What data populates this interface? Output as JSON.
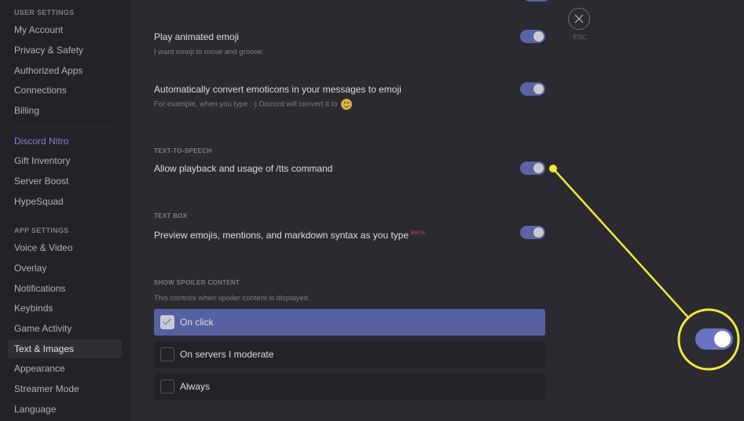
{
  "sidebar": {
    "user_settings_header": "USER SETTINGS",
    "user_items": [
      {
        "label": "My Account"
      },
      {
        "label": "Privacy & Safety"
      },
      {
        "label": "Authorized Apps"
      },
      {
        "label": "Connections"
      },
      {
        "label": "Billing"
      }
    ],
    "nitro_items": [
      {
        "label": "Discord Nitro"
      },
      {
        "label": "Gift Inventory"
      },
      {
        "label": "Server Boost"
      },
      {
        "label": "HypeSquad"
      }
    ],
    "app_settings_header": "APP SETTINGS",
    "app_items": [
      {
        "label": "Voice & Video"
      },
      {
        "label": "Overlay"
      },
      {
        "label": "Notifications"
      },
      {
        "label": "Keybinds"
      },
      {
        "label": "Game Activity"
      },
      {
        "label": "Text & Images",
        "active": true
      },
      {
        "label": "Appearance"
      },
      {
        "label": "Streamer Mode"
      },
      {
        "label": "Language"
      }
    ]
  },
  "settings": {
    "animated_emoji": {
      "title": "Play animated emoji",
      "description": "I want emoji to move and groove.",
      "enabled": true
    },
    "convert_emoticons": {
      "title": "Automatically convert emoticons in your messages to emoji",
      "description": "For example, when you type :-) Discord will convert it to",
      "emoji_icon": "slightly-smiling-face-icon",
      "enabled": true
    },
    "tts": {
      "section_label": "TEXT-TO-SPEECH",
      "title": "Allow playback and usage of /tts command",
      "enabled": true
    },
    "text_box": {
      "section_label": "TEXT BOX",
      "title": "Preview emojis, mentions, and markdown syntax as you type",
      "badge": "BETA",
      "enabled": true
    },
    "spoiler": {
      "section_label": "SHOW SPOILER CONTENT",
      "description": "This controls when spoiler content is displayed.",
      "options": [
        {
          "label": "On click",
          "selected": true
        },
        {
          "label": "On servers I moderate",
          "selected": false
        },
        {
          "label": "Always",
          "selected": false
        }
      ]
    }
  },
  "close": {
    "icon": "close-icon",
    "label": "ESC"
  },
  "colors": {
    "accent": "#5a63a3",
    "selected_option": "#5561a0",
    "annotation": "#f2e93a",
    "beta": "#c04a4a"
  }
}
